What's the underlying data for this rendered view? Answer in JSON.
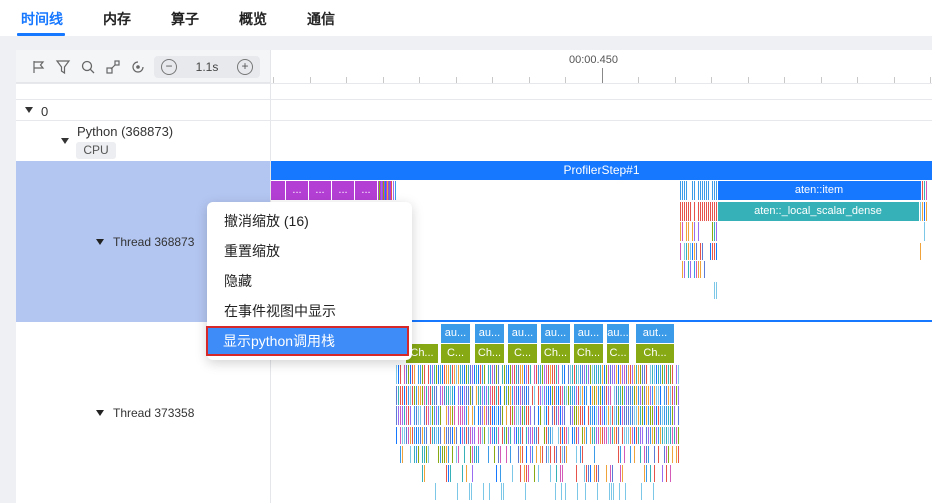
{
  "tabs": [
    {
      "label": "时间线",
      "active": true
    },
    {
      "label": "内存",
      "active": false
    },
    {
      "label": "算子",
      "active": false
    },
    {
      "label": "概览",
      "active": false
    },
    {
      "label": "通信",
      "active": false
    }
  ],
  "toolbar": {
    "icons": [
      "flag-icon",
      "filter-icon",
      "search-icon",
      "link-icon",
      "reset-icon"
    ],
    "zoom_value": "1.1s",
    "zoom_out_glyph": "−",
    "zoom_in_glyph": "+"
  },
  "ruler": {
    "label": "00:00.450"
  },
  "tree": {
    "root_label": "0",
    "process_label": "Python (368873)",
    "process_badge": "CPU",
    "thread1_label": "Thread 368873",
    "thread2_label": "Thread 373358"
  },
  "timeline": {
    "profiler_step": "ProfilerStep#1",
    "aten_item": "aten::item",
    "aten_dense": "aten::_local_scalar_dense",
    "short_label": "...",
    "aut_label": "aut...",
    "au_label": "au...",
    "ch_label": "Ch...",
    "c_label": "C..."
  },
  "context_menu": [
    {
      "label": "撤消缩放 (16)",
      "highlighted": false
    },
    {
      "label": "重置缩放",
      "highlighted": false
    },
    {
      "label": "隐藏",
      "highlighted": false
    },
    {
      "label": "在事件视图中显示",
      "highlighted": false
    },
    {
      "label": "显示python调用栈",
      "highlighted": true
    }
  ],
  "colors": {
    "accent": "#1677ff",
    "purple": "#b43fd4",
    "teal": "#36b1b8",
    "green": "#87a914",
    "menu_highlight": "#3d8cf7",
    "menu_border": "#d62828"
  }
}
